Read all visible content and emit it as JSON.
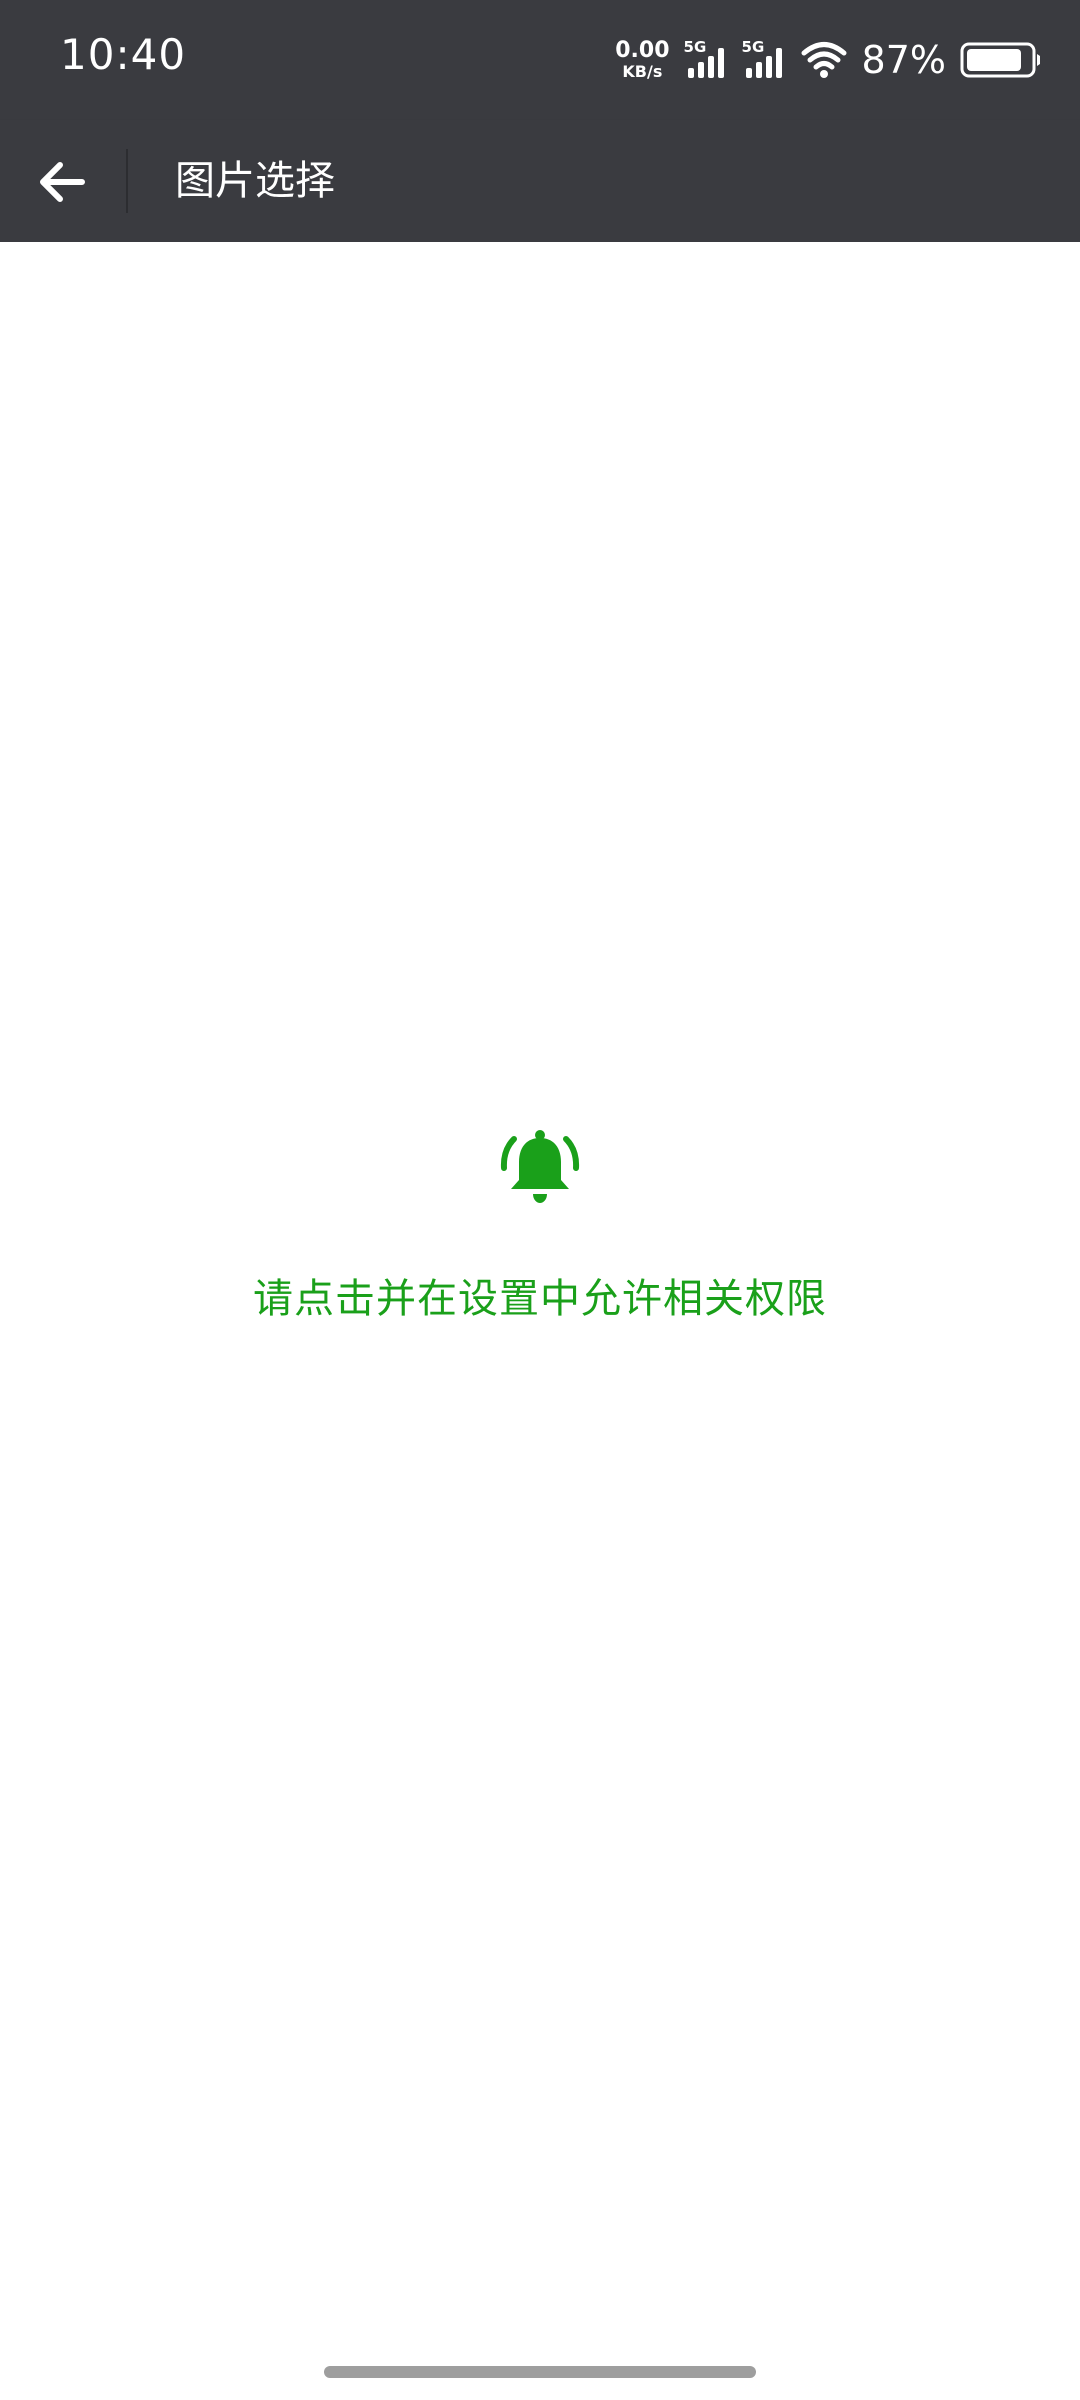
{
  "status_bar": {
    "time": "10:40",
    "net_speed_value": "0.00",
    "net_speed_unit": "KB/s",
    "sim1_type": "5G",
    "sim2_type": "5G",
    "battery_percent": "87%",
    "battery_level": 0.87,
    "icons": [
      "signal-icon",
      "signal-icon",
      "wifi-icon",
      "battery-icon"
    ]
  },
  "app_bar": {
    "title": "图片选择",
    "back_icon": "arrow-left-icon"
  },
  "main": {
    "alert_icon": "bell-ring-icon",
    "message": "请点击并在设置中允许相关权限"
  },
  "colors": {
    "bar_background": "#3a3b40",
    "accent_green": "#1aa01a",
    "page_background": "#ffffff"
  }
}
